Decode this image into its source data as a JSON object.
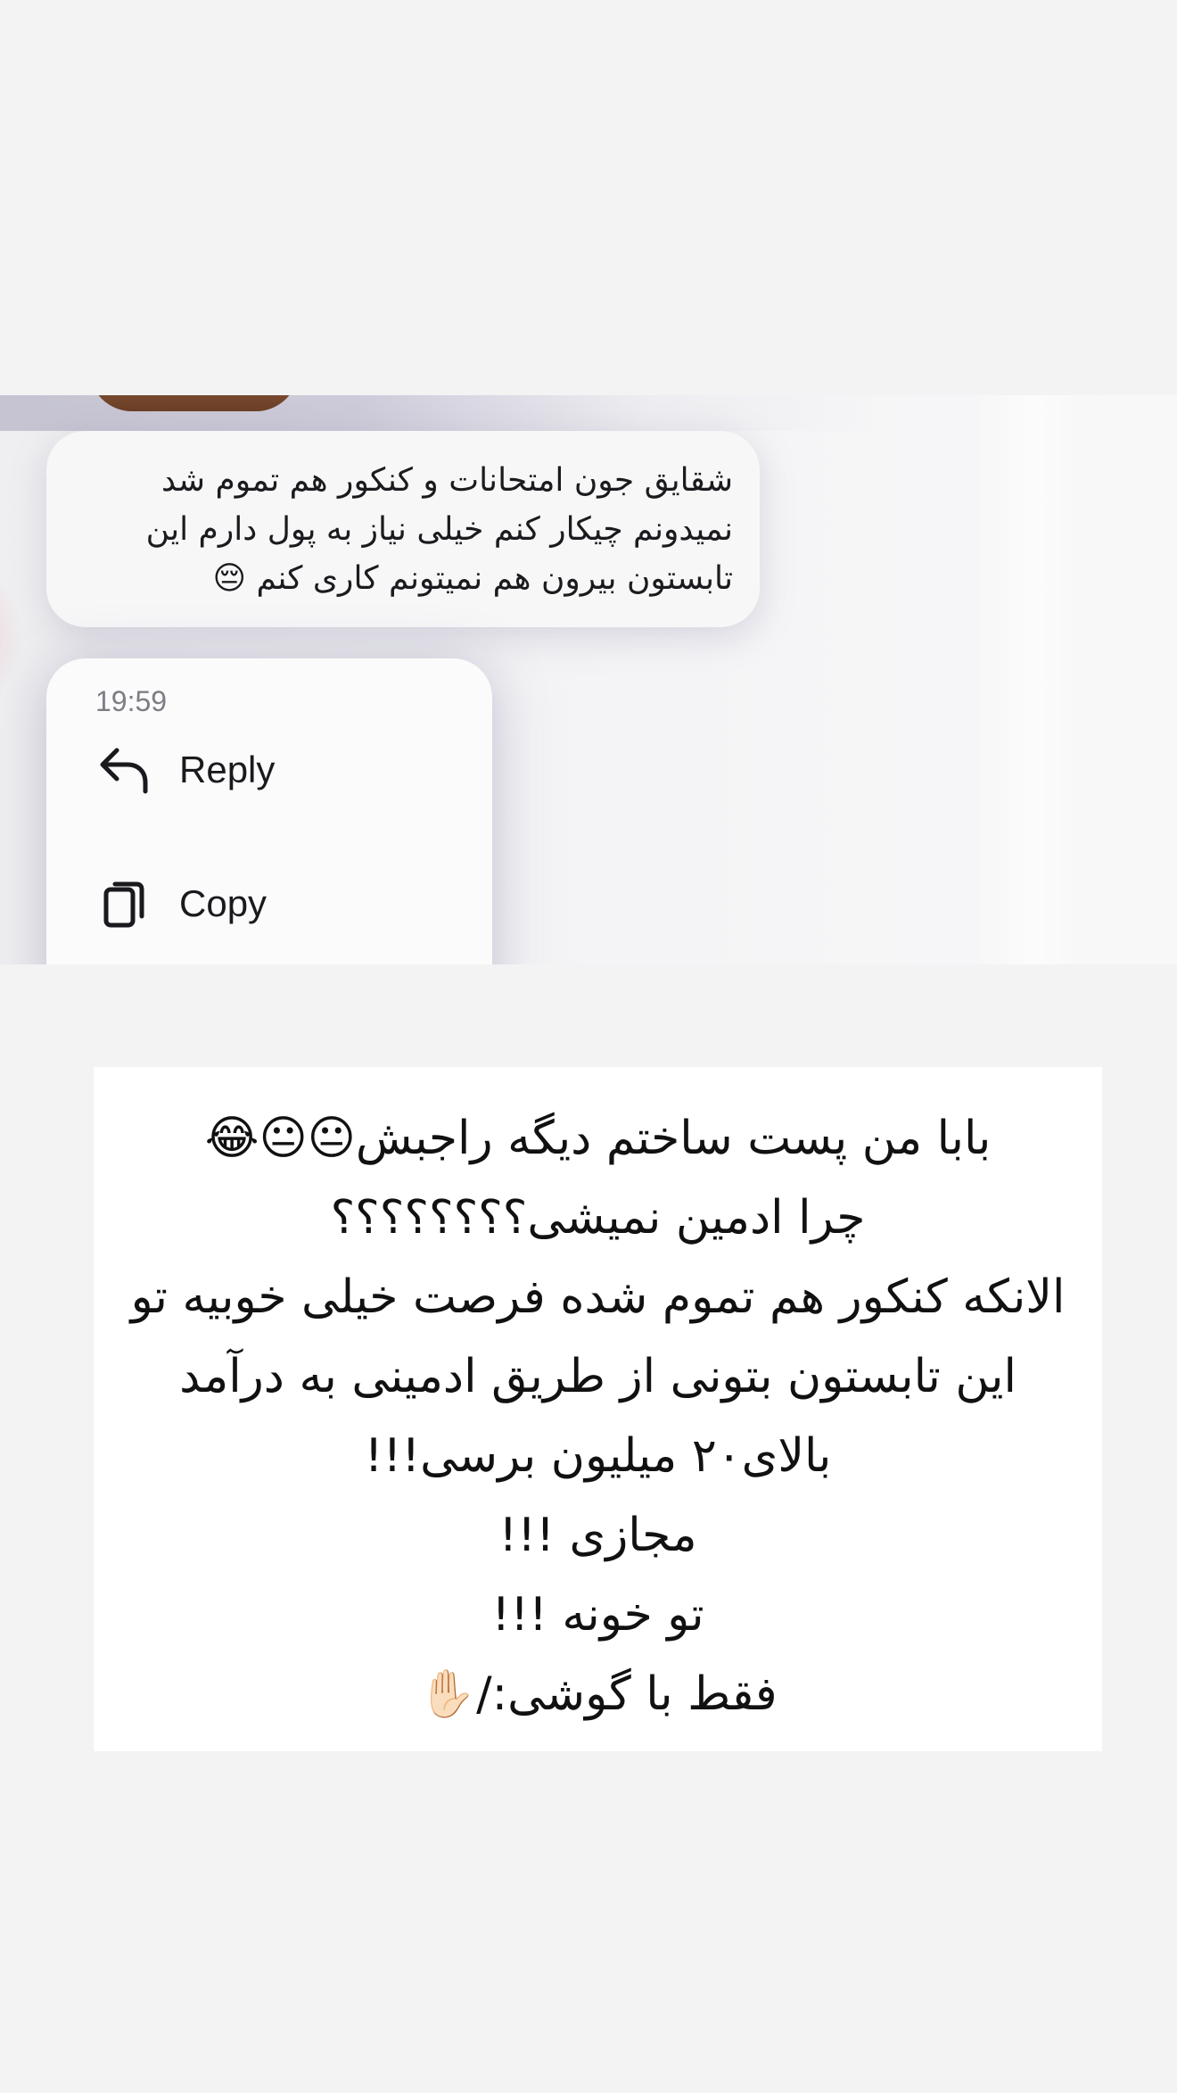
{
  "chat_screenshot": {
    "message": {
      "lines": [
        "شقایق جون امتحانات و کنکور هم تموم شد",
        "نمیدونم چیکار کنم خیلی نیاز به پول دارم این",
        "تابستون بیرون هم نمیتونم کاری کنم 😔"
      ]
    },
    "context_menu": {
      "time": "19:59",
      "reply_label": "Reply",
      "copy_label": "Copy",
      "reply_icon": "reply-arrow-icon",
      "copy_icon": "copy-icon"
    }
  },
  "text_card": {
    "lines": [
      "بابا من پست ساختم دیگه راجبش😐😐😂",
      "چرا ادمین نمیشی؟؟؟؟؟؟؟؟",
      "الانکه کنکور هم تموم شده فرصت خیلی خوبیه تو",
      "این تابستون بتونی از طریق ادمینی به درآمد",
      "بالای۲۰ میلیون برسی!!!",
      "مجازی !!!",
      "تو خونه !!!",
      "فقط با گوشی:/✋🏻"
    ]
  }
}
